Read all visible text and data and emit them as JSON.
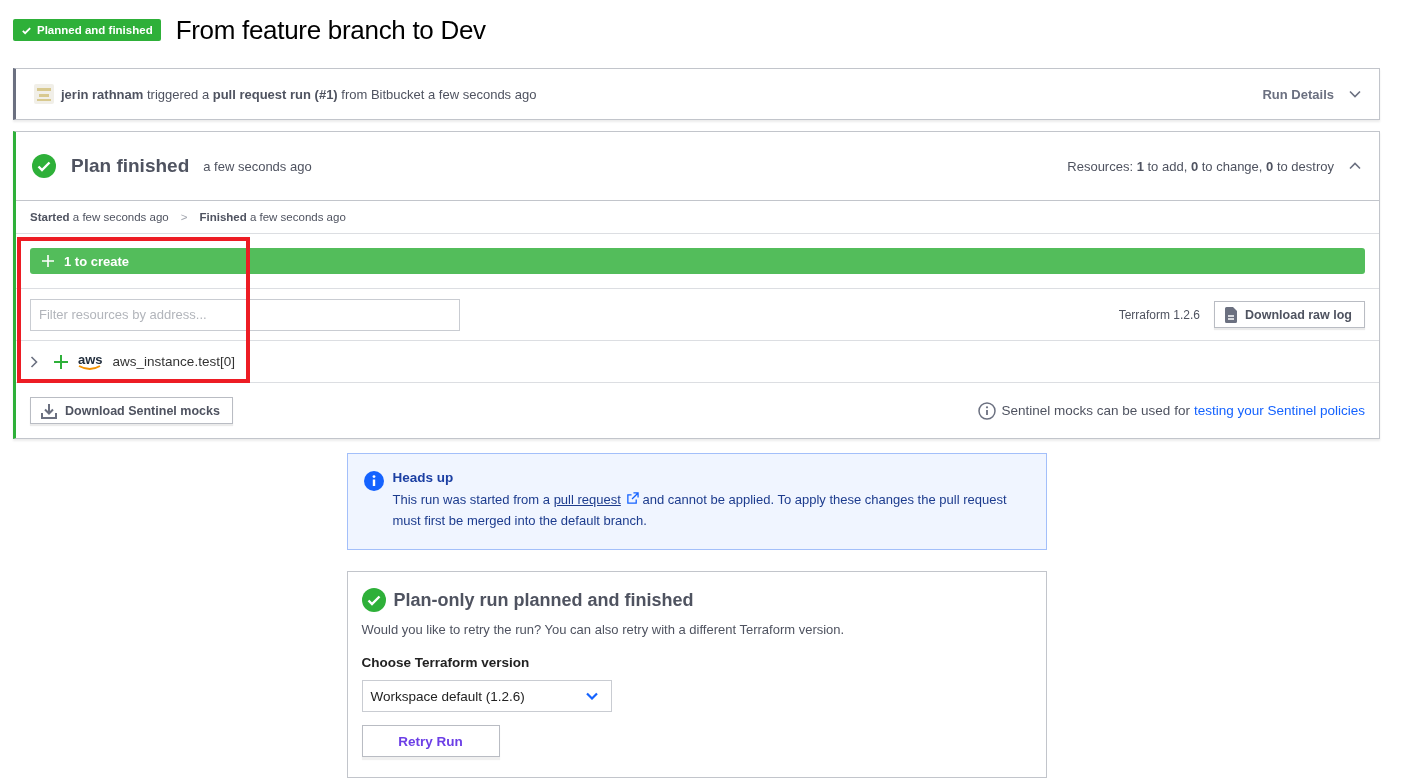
{
  "header": {
    "badge": "Planned and finished",
    "title": "From feature branch to Dev"
  },
  "trigger": {
    "text": "**jerin rathnam** triggered a **pull request run (#1)** from Bitbucket a few seconds ago",
    "details_label": "Run Details",
    "expanded": false
  },
  "plan": {
    "title": "Plan finished",
    "time": "a few seconds ago",
    "resources": "Resources: **1** to add, **0** to change, **0** to destroy",
    "expanded": true,
    "timeline": [
      {
        "text": "**Started** a few seconds ago"
      },
      {
        "text": "**Finished** a few seconds ago"
      }
    ],
    "separator": ">",
    "create_bar": "1 to create",
    "filter": {
      "placeholder": "Filter resources by address..."
    },
    "terraform_version": "Terraform 1.2.6",
    "download_log": "Download raw log",
    "resources_list": [
      {
        "address": "aws_instance.test[0]",
        "provider": "aws",
        "expanded": false
      }
    ],
    "download_mocks": "Download Sentinel mocks",
    "mocks_note": "Sentinel mocks can be used for",
    "mocks_link": "testing your Sentinel policies"
  },
  "notice": {
    "title": "Heads up",
    "before": "This run was started from a",
    "link": "pull request",
    "after": "and cannot be applied. To apply these changes the pull request must first be merged into the default branch."
  },
  "retry": {
    "title": "Plan-only run planned and finished",
    "text": "Would you like to retry the run? You can also retry with a different Terraform version.",
    "select_label": "Choose Terraform version",
    "select_value": "Workspace default (1.2.6)",
    "button": "Retry Run"
  }
}
